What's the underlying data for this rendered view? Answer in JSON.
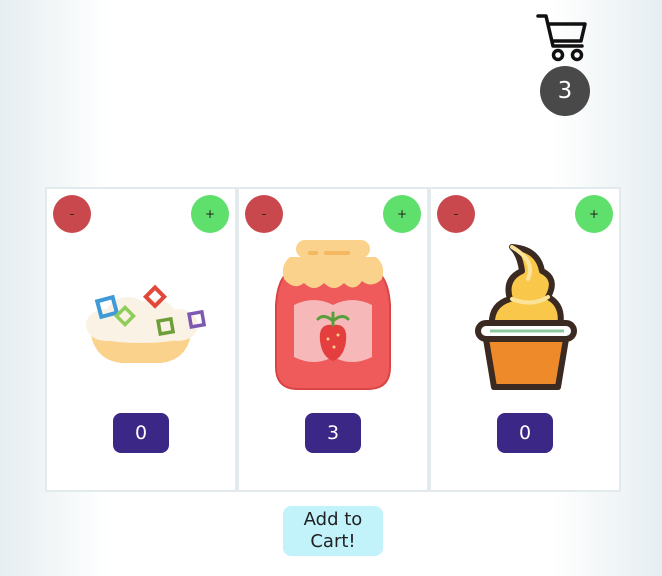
{
  "cart": {
    "icon": "shopping-cart-icon",
    "count": "3"
  },
  "products": [
    {
      "name_icon": "shaved-ice-icon",
      "minus_label": "-",
      "plus_label": "+",
      "quantity": "0"
    },
    {
      "name_icon": "strawberry-jam-jar-icon",
      "minus_label": "-",
      "plus_label": "+",
      "quantity": "3"
    },
    {
      "name_icon": "soft-serve-cupcake-icon",
      "minus_label": "-",
      "plus_label": "+",
      "quantity": "0"
    }
  ],
  "actions": {
    "add_to_cart_line1": "Add to",
    "add_to_cart_line2": "Cart!"
  },
  "colors": {
    "minus": "#c9484e",
    "plus": "#5fdf6b",
    "quantity_badge": "#3b2786",
    "cart_count_bg": "#494949",
    "add_to_cart_bg": "#c2f3fb"
  }
}
